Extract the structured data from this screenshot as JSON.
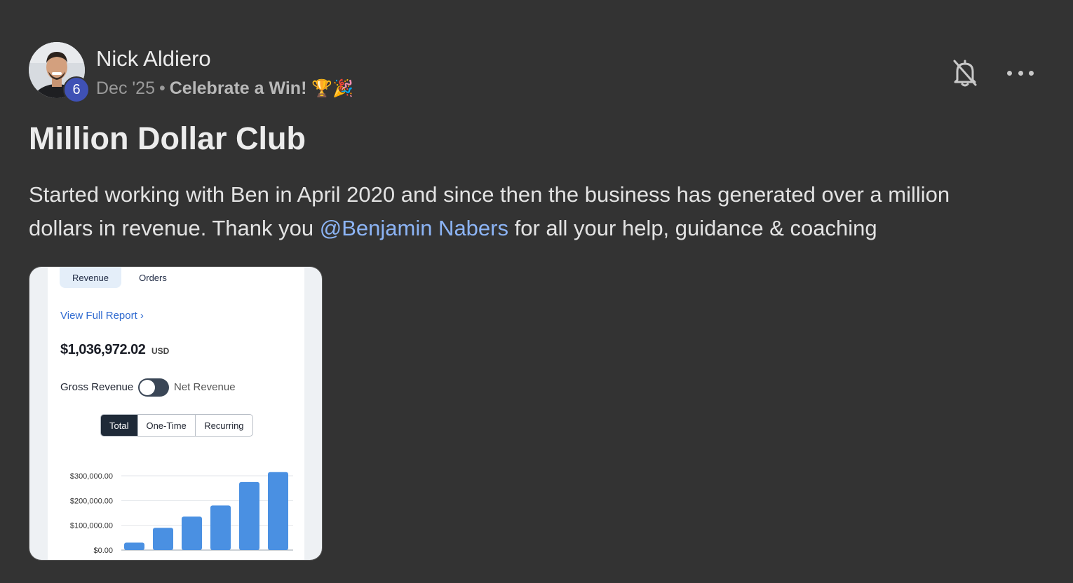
{
  "author": {
    "name": "Nick Aldiero",
    "level": "6"
  },
  "meta": {
    "date": "Dec '25",
    "separator": "•",
    "category": "Celebrate a Win!",
    "category_emoji": "🏆🎉"
  },
  "actions": {
    "bell_icon": "bell-off-icon",
    "more_icon": "more-horizontal-icon"
  },
  "post": {
    "title": "Million Dollar Club",
    "body_before": "Started working with Ben in April 2020 and since then the business has generated over a million dollars in revenue. Thank you ",
    "mention": "@Benjamin Nabers",
    "body_after": " for all your help, guidance & coaching"
  },
  "attachment": {
    "tabs": [
      "Revenue",
      "Orders"
    ],
    "report_link": "View Full Report ›",
    "amount": "$1,036,972.02",
    "currency": "USD",
    "toggle_left": "Gross Revenue",
    "toggle_right": "Net Revenue",
    "segments": [
      "Total",
      "One-Time",
      "Recurring"
    ],
    "active_segment": "Total",
    "chart_data": {
      "type": "bar",
      "title": "",
      "xlabel": "",
      "ylabel": "",
      "ylim": [
        0,
        300000
      ],
      "y_ticks": [
        "$0.00",
        "$100,000.00",
        "$200,000.00",
        "$300,000.00"
      ],
      "categories": [
        "",
        "",
        "",
        "",
        "",
        ""
      ],
      "values": [
        30000,
        90000,
        135000,
        180000,
        275000,
        315000
      ],
      "bar_color": "#4a90e2",
      "grid": true
    }
  },
  "colors": {
    "background": "#333333",
    "mention": "#8cb4f5",
    "badge": "#3f51b5"
  }
}
